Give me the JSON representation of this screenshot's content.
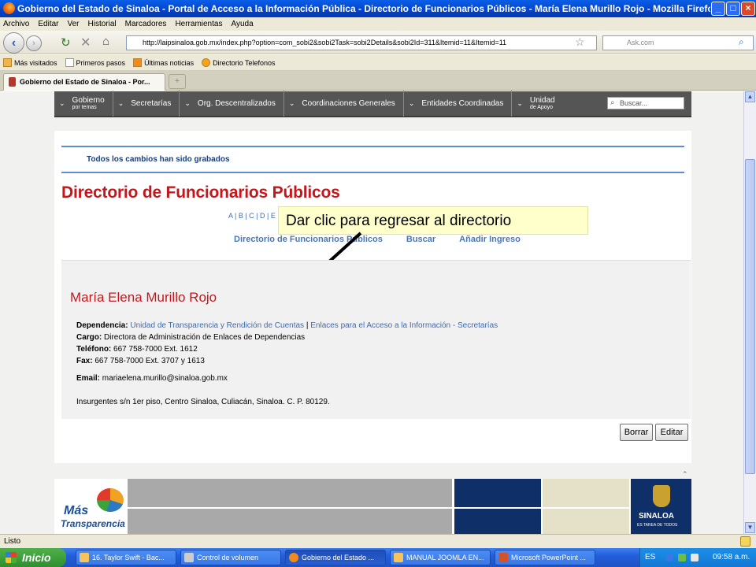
{
  "window": {
    "title": "Gobierno del Estado de Sinaloa - Portal de Acceso a la Información Pública - Directorio de Funcionarios Públicos - María Elena Murillo Rojo - Mozilla Firefox"
  },
  "menu": [
    "Archivo",
    "Editar",
    "Ver",
    "Historial",
    "Marcadores",
    "Herramientas",
    "Ayuda"
  ],
  "browser": {
    "url": "http://laipsinaloa.gob.mx/index.php?option=com_sobi2&sobi2Task=sobi2Details&sobi2Id=311&Itemid=11&Itemid=11",
    "search_placeholder": "Ask.com",
    "bookmarks": [
      "Más visitados",
      "Primeros pasos",
      "Últimas noticias",
      "Directorio Telefonos"
    ],
    "tab_title": "Gobierno del Estado de Sinaloa - Por...",
    "new_tab": "+"
  },
  "sitenav": {
    "items": [
      {
        "label": "Gobierno",
        "sub": "por temas"
      },
      {
        "label": "Secretarías",
        "sub": ""
      },
      {
        "label": "Org. Descentralizados",
        "sub": ""
      },
      {
        "label": "Coordinaciones Generales",
        "sub": ""
      },
      {
        "label": "Entidades Coordinadas",
        "sub": ""
      },
      {
        "label": "Unidad",
        "sub": "de Apoyo"
      }
    ],
    "search_placeholder": "Buscar..."
  },
  "page": {
    "saved_message": "Todos los cambios han sido grabados",
    "title": "Directorio de Funcionarios Públicos",
    "alphabet": "A | B | C | D | E",
    "subnav": [
      "Directorio de Funcionarios Públicos",
      "Buscar",
      "Añadir Ingreso"
    ],
    "callout": "Dar clic para regresar al directorio"
  },
  "person": {
    "name": "María Elena Murillo Rojo",
    "dependencia_label": "Dependencia:",
    "dependencia_link1": "Unidad de Transparencia y Rendición de Cuentas",
    "separator": "|",
    "dependencia_link2": "Enlaces para el Acceso a la Información - Secretarías",
    "cargo_label": "Cargo:",
    "cargo": "Directora de Administración de Enlaces de Dependencias",
    "telefono_label": "Teléfono:",
    "telefono": "667 758-7000 Ext. 1612",
    "fax_label": "Fax:",
    "fax": "667 758-7000 Ext. 3707 y 1613",
    "email_label": "Email:",
    "email": "mariaelena.murillo@sinaloa.gob.mx",
    "address": "Insurgentes s/n 1er piso, Centro Sinaloa, Culiacán, Sinaloa. C. P. 80129."
  },
  "actions": {
    "delete": "Borrar",
    "edit": "Editar"
  },
  "footer": {
    "logo_line1": "Más",
    "logo_line2": "Transparencia",
    "state_logo": "SINALOA",
    "state_tagline": "ES TAREA DE TODOS"
  },
  "status": "Listo",
  "taskbar": {
    "start": "Inicio",
    "tasks": [
      "16. Taylor Swift - Bac...",
      "Control de volumen",
      "Gobierno del Estado ...",
      "MANUAL JOOMLA EN...",
      "Microsoft PowerPoint ..."
    ],
    "lang": "ES",
    "clock": "09:58 a.m."
  },
  "colors": {
    "title_red": "#c4171c",
    "link_blue": "#3c6ab3",
    "callout_bg": "#ffffcc",
    "nav_gray": "#555555"
  }
}
